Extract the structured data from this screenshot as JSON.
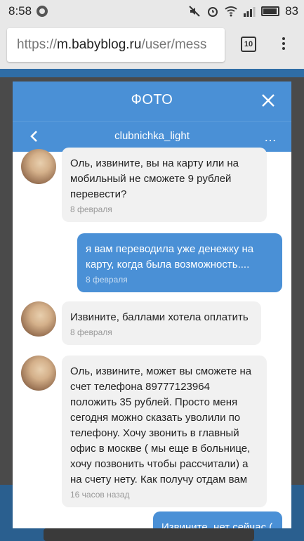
{
  "status_bar": {
    "time": "8:58",
    "battery": "83"
  },
  "browser": {
    "url_scheme": "https://",
    "url_host": "m.babyblog.ru",
    "url_path": "/user/mess",
    "tab_count": "10"
  },
  "modal": {
    "title": "ФОТО",
    "chat_user": "clubnichka_light",
    "more_label": "…"
  },
  "messages": [
    {
      "side": "in",
      "text": "Оль, извините, вы на карту или на мобильный не сможете 9 рублей перевести?",
      "time": "8 февраля"
    },
    {
      "side": "out",
      "text": "я вам переводила уже денежку на карту, когда была возможность....",
      "time": "8 февраля"
    },
    {
      "side": "in",
      "text": "Извините, баллами хотела оплатить",
      "time": "8 февраля"
    },
    {
      "side": "in",
      "text": "Оль, извините, может вы сможете на счет телефона 89777123964 положить 35 рублей. Просто меня сегодня можно сказать уволили по телефону. Хочу звонить в главный офис в москве ( мы еще в больнице, хочу позвонить чтобы рассчитали) а на счету нету. Как получу отдам вам",
      "time": "16 часов назад"
    },
    {
      "side": "out",
      "text": "Извините, нет сейчас (",
      "time": ""
    }
  ],
  "colors": {
    "header_blue": "#4a90d6",
    "incoming_bubble": "#f1f1f1",
    "outgoing_bubble": "#4a90d6"
  }
}
